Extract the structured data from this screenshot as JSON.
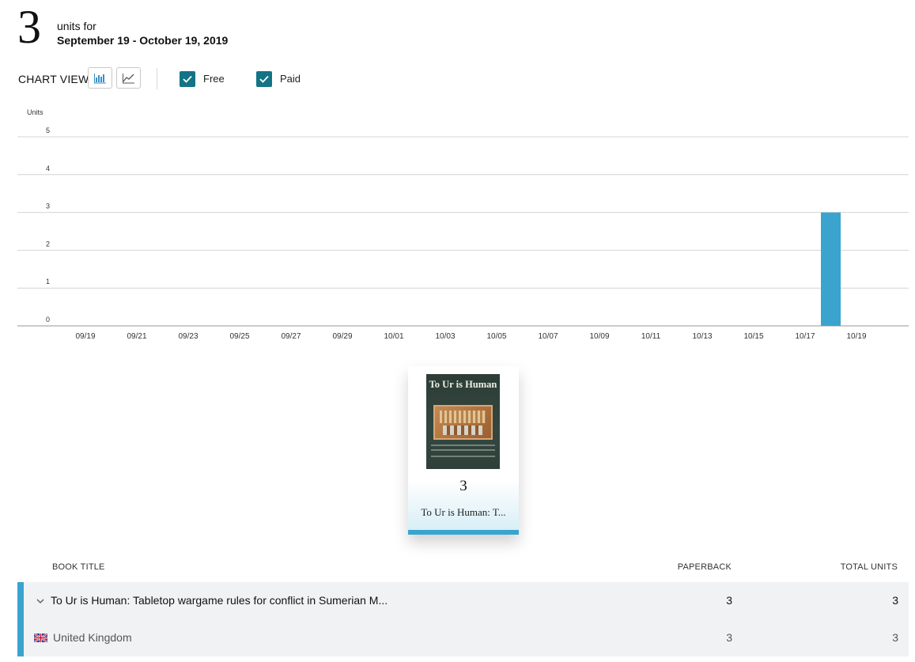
{
  "summary": {
    "total_units": "3",
    "units_for_label": "units for",
    "date_range": "September 19 - October 19, 2019"
  },
  "toolbar": {
    "chart_view_label": "CHART VIEW",
    "bar_view_icon": "bar-chart-icon",
    "line_view_icon": "line-chart-icon",
    "filters": [
      {
        "label": "Free",
        "checked": true
      },
      {
        "label": "Paid",
        "checked": true
      }
    ],
    "checkbox_color": "#137485"
  },
  "chart_data": {
    "type": "bar",
    "ylabel": "Units",
    "ylim": [
      0,
      5
    ],
    "yticks": [
      0,
      1,
      2,
      3,
      4,
      5
    ],
    "grid": true,
    "bar_color": "#3aa4cf",
    "x_tick_labels": [
      "09/19",
      "09/21",
      "09/23",
      "09/25",
      "09/27",
      "09/29",
      "10/01",
      "10/03",
      "10/05",
      "10/07",
      "10/09",
      "10/11",
      "10/13",
      "10/15",
      "10/17",
      "10/19"
    ],
    "categories": [
      "09/19",
      "09/20",
      "09/21",
      "09/22",
      "09/23",
      "09/24",
      "09/25",
      "09/26",
      "09/27",
      "09/28",
      "09/29",
      "09/30",
      "10/01",
      "10/02",
      "10/03",
      "10/04",
      "10/05",
      "10/06",
      "10/07",
      "10/08",
      "10/09",
      "10/10",
      "10/11",
      "10/12",
      "10/13",
      "10/14",
      "10/15",
      "10/16",
      "10/17",
      "10/18",
      "10/19"
    ],
    "values": [
      0,
      0,
      0,
      0,
      0,
      0,
      0,
      0,
      0,
      0,
      0,
      0,
      0,
      0,
      0,
      0,
      0,
      0,
      0,
      0,
      0,
      0,
      0,
      0,
      0,
      0,
      0,
      0,
      0,
      3,
      0
    ]
  },
  "book_card": {
    "cover_title": "To Ur is Human",
    "units": "3",
    "title": "To Ur is Human: T..."
  },
  "table": {
    "headers": {
      "book_title": "BOOK TITLE",
      "paperback": "PAPERBACK",
      "total_units": "TOTAL UNITS"
    },
    "book_row": {
      "title": "To Ur is Human: Tabletop wargame rules for conflict in Sumerian M...",
      "paperback": "3",
      "total": "3"
    },
    "country_row": {
      "name": "United Kingdom",
      "flag_icon": "uk-flag-icon",
      "paperback": "3",
      "total": "3"
    },
    "accent_color": "#3aa4cf"
  }
}
